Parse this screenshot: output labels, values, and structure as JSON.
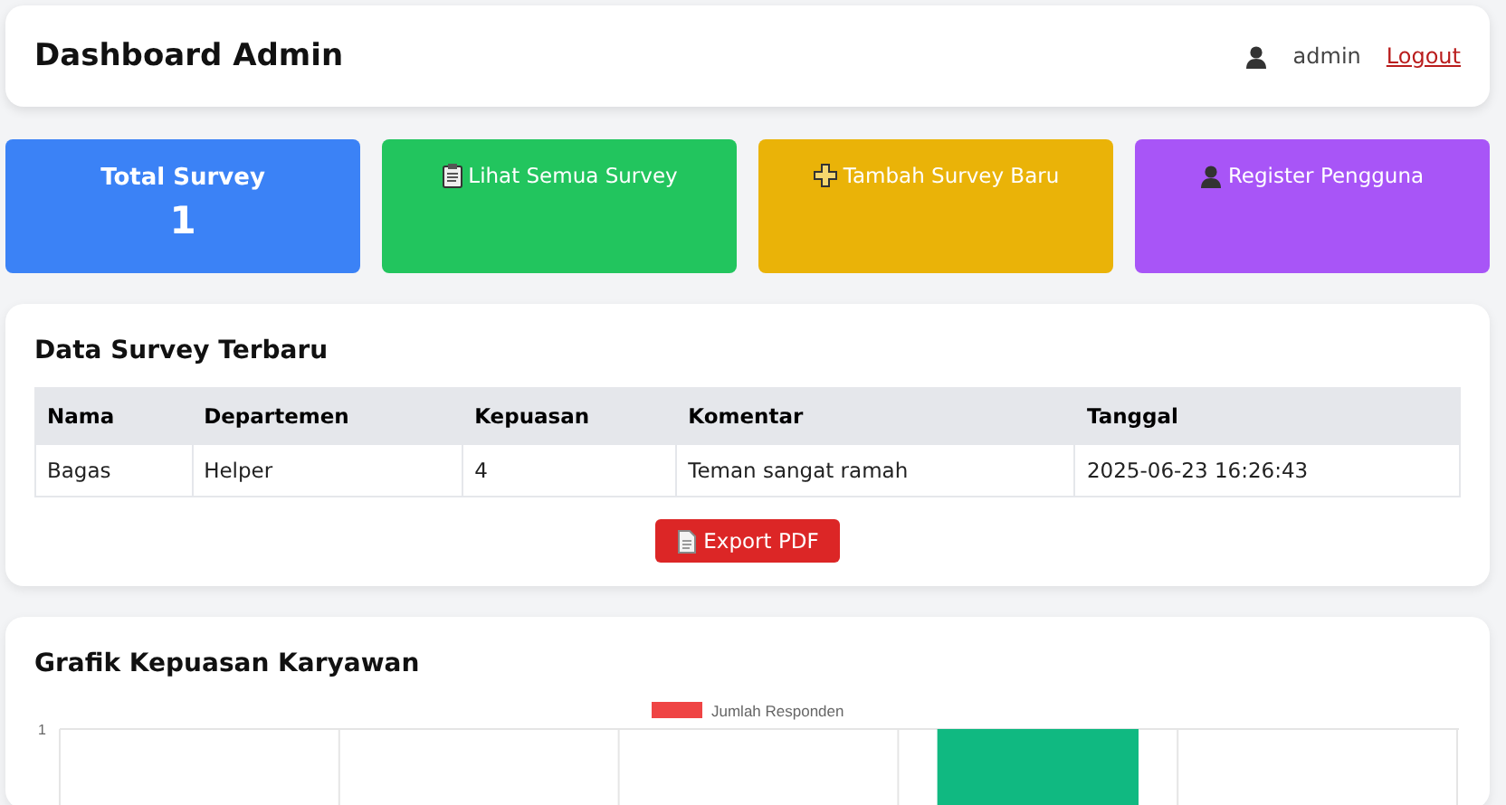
{
  "header": {
    "title": "Dashboard Admin",
    "user": "admin",
    "logout": "Logout"
  },
  "cards": [
    {
      "kind": "stat",
      "label": "Total Survey",
      "value": "1",
      "color": "#3b82f6"
    },
    {
      "kind": "link",
      "label": "Lihat Semua Survey",
      "color": "#22c55e"
    },
    {
      "kind": "link",
      "label": "Tambah Survey Baru",
      "color": "#eab308"
    },
    {
      "kind": "link",
      "label": "Register Pengguna",
      "color": "#a855f7"
    }
  ],
  "survey_table": {
    "title": "Data Survey Terbaru",
    "columns": [
      "Nama",
      "Departemen",
      "Kepuasan",
      "Komentar",
      "Tanggal"
    ],
    "rows": [
      [
        "Bagas",
        "Helper",
        "4",
        "Teman sangat ramah",
        "2025-06-23 16:26:43"
      ]
    ],
    "export_button": "Export PDF"
  },
  "chart_panel": {
    "title": "Grafik Kepuasan Karyawan",
    "legend": "Jumlah Responden",
    "y_tick": "1"
  }
}
